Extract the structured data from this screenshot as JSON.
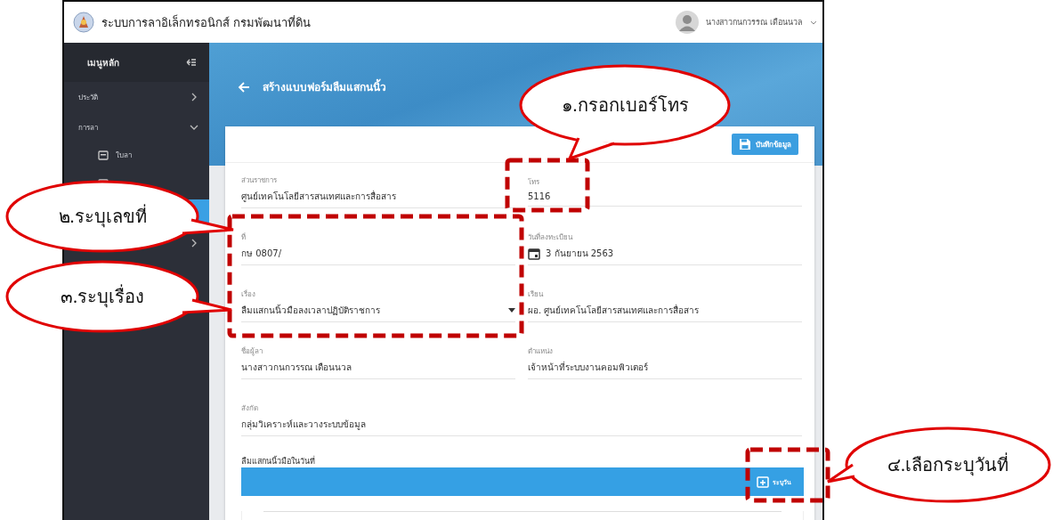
{
  "app": {
    "title": "ระบบการลาอิเล็กทรอนิกส์ กรมพัฒนาที่ดิน",
    "user_name": "นางสาวกนกวรรณ เดือนนวล"
  },
  "sidebar": {
    "title": "เมนูหลัก",
    "items": [
      {
        "label": "ประวัติ",
        "expanded": false,
        "selected": false
      },
      {
        "label": "การลา",
        "expanded": true,
        "selected": false,
        "children": [
          {
            "label": "ใบลา",
            "selected": false
          },
          {
            "selected": false
          },
          {
            "selected": true
          }
        ]
      },
      {
        "expanded": false,
        "selected": false
      }
    ]
  },
  "page": {
    "title": "สร้างแบบฟอร์มลืมแสกนนิ้ว",
    "save_button": "บันทึกข้อมูล"
  },
  "fields": [
    {
      "kind": "text",
      "label": "ส่วนราชการ",
      "value": "ศูนย์เทคโนโลยีสารสนเทศและการสื่อสาร"
    },
    {
      "kind": "text",
      "label": "โทร",
      "value": "5116"
    },
    {
      "kind": "text",
      "label": "ที่",
      "value": "กษ 0807/"
    },
    {
      "kind": "date",
      "label": "วันที่ลงทะเบียน",
      "value": "3 กันยายน 2563"
    },
    {
      "kind": "select",
      "label": "เรื่อง",
      "value": "ลืมแสกนนิ้วมือลงเวลาปฏิบัติราชการ"
    },
    {
      "kind": "text",
      "label": "เรียน",
      "value": "ผอ. ศูนย์เทคโนโลยีสารสนเทศและการสื่อสาร"
    },
    {
      "kind": "text",
      "label": "ชื่อผู้ลา",
      "value": "นางสาวกนกวรรณ เดือนนวล"
    },
    {
      "kind": "text",
      "label": "ตำแหน่ง",
      "value": "เจ้าหน้าที่ระบบงานคอมพิวเตอร์"
    },
    {
      "kind": "wide",
      "label": "สังกัด",
      "value": "กลุ่มวิเคราะห์และวางระบบข้อมูล"
    }
  ],
  "date_section": {
    "title": "ลืมแสกนนิ้วมือในวันที่",
    "button": "ระบุวัน"
  },
  "annotations": [
    {
      "text": "๑.กรอกเบอร์โทร"
    },
    {
      "text": "๒.ระบุเลขที่"
    },
    {
      "text": "๓.ระบุเรื่อง"
    },
    {
      "text": "๔.เลือกระบุวันที่"
    }
  ]
}
